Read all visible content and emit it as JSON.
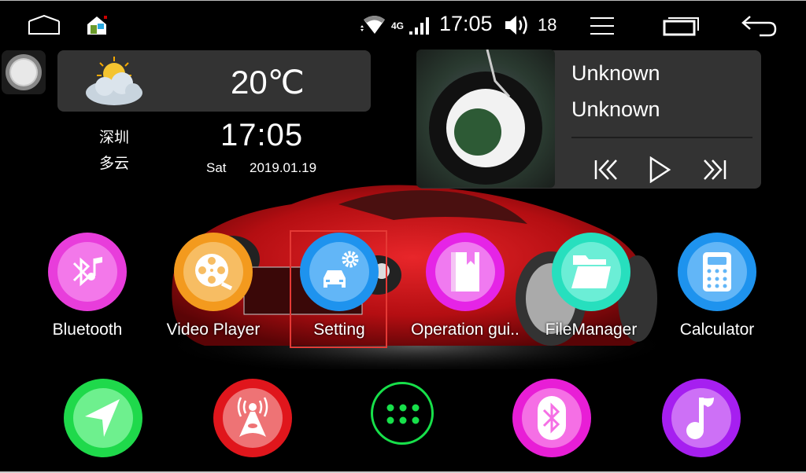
{
  "status_bar": {
    "icons": [
      "home-outline-icon",
      "launcher-home-icon",
      "wifi-icon",
      "4g-icon",
      "signal-icon",
      "volume-icon",
      "menu-icon",
      "recent-apps-icon",
      "back-icon"
    ],
    "network_label": "4G",
    "time": "17:05",
    "volume": "18"
  },
  "weather": {
    "icon": "partly-cloudy-icon",
    "temperature": "20℃",
    "city": "深圳",
    "condition": "多云"
  },
  "clock": {
    "time": "17:05",
    "day": "Sat",
    "date": "2019.01.19"
  },
  "music": {
    "title": "Unknown",
    "artist": "Unknown",
    "controls": [
      "previous-icon",
      "play-icon",
      "next-icon"
    ]
  },
  "apps": [
    {
      "label": "Bluetooth",
      "icon": "bluetooth-music-icon",
      "ring": "#e83ddb",
      "fill": "#f378ea"
    },
    {
      "label": "Video Player",
      "icon": "film-reel-icon",
      "ring": "#f39a1e",
      "fill": "#f7bd63"
    },
    {
      "label": "Setting",
      "icon": "car-settings-icon",
      "ring": "#1e93ee",
      "fill": "#62b6f7"
    },
    {
      "label": "Operation gui..",
      "icon": "book-icon",
      "ring": "#e524e6",
      "fill": "#f07af0"
    },
    {
      "label": "FileManager",
      "icon": "folder-icon",
      "ring": "#27dfbe",
      "fill": "#6beed6"
    },
    {
      "label": "Calculator",
      "icon": "calculator-icon",
      "ring": "#1e93ee",
      "fill": "#62b6f7"
    }
  ],
  "dock": [
    {
      "name": "navigation",
      "icon": "navigation-arrow-icon",
      "ring": "#1fd94b",
      "fill": "#6ef08e"
    },
    {
      "name": "radio",
      "icon": "radio-tower-icon",
      "ring": "#e0161c",
      "fill": "#ee7375"
    },
    {
      "name": "all-apps",
      "icon": "app-drawer-icon",
      "ring": "#17e04a",
      "fill": "#000000"
    },
    {
      "name": "bluetooth",
      "icon": "bluetooth-icon",
      "ring": "#e81ed6",
      "fill": "#f56fe5"
    },
    {
      "name": "music",
      "icon": "music-note-icon",
      "ring": "#a61ff0",
      "fill": "#cd70f6"
    }
  ],
  "highlighted_app": "Setting"
}
